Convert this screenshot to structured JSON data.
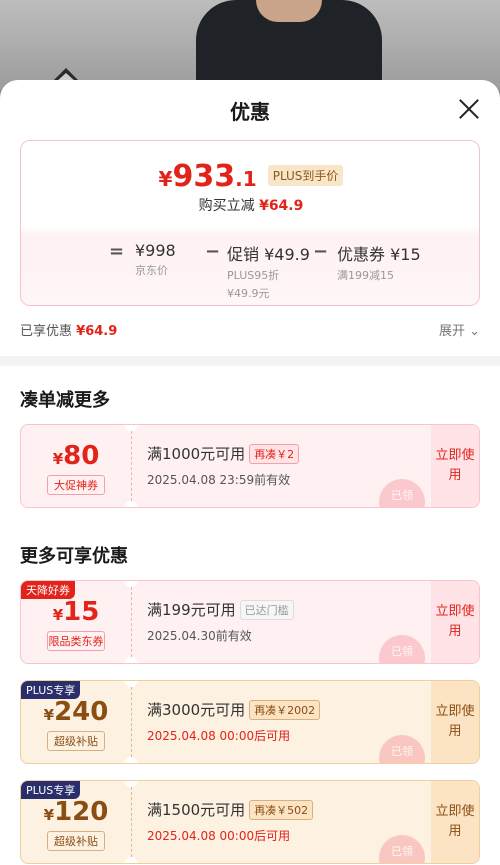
{
  "sheet": {
    "title": "优惠"
  },
  "summary": {
    "final_yen": "¥",
    "final_int": "933",
    "final_dec": ".1",
    "plus_tag": "PLUS到手价",
    "save_label": "购买立减",
    "save_amount": "¥64.9",
    "formula": {
      "eq": "=",
      "minus1": "−",
      "minus2": "−",
      "base_price": "¥998",
      "base_label": "京东价",
      "promo_price": "促销 ¥49.9",
      "promo_sub1": "PLUS95折",
      "promo_sub2": "¥49.9元",
      "coupon_price": "优惠券 ¥15",
      "coupon_sub": "满199减15"
    },
    "enjoyed_label": "已享优惠",
    "enjoyed_amount": "¥64.9",
    "expand_label": "展开"
  },
  "sections": {
    "combine_title": "凑单减更多",
    "more_title": "更多可享优惠"
  },
  "coupons": [
    {
      "yen": "¥",
      "value": "80",
      "type": "大促神券",
      "condition": "满1000元可用",
      "badge": "再凑￥2",
      "date": "2025.04.08 23:59前有效",
      "action": "立即使用",
      "stamp": "已领"
    },
    {
      "corner": "天降好券",
      "yen": "¥",
      "value": "15",
      "type": "限品类东券",
      "condition": "满199元可用",
      "badge": "已达门槛",
      "date": "2025.04.30前有效",
      "action": "立即使用",
      "stamp": "已领"
    },
    {
      "corner": "PLUS专享",
      "yen": "¥",
      "value": "240",
      "type": "超级补贴",
      "condition": "满3000元可用",
      "badge": "再凑￥2002",
      "date": "2025.04.08 00:00后可用",
      "action": "立即使用",
      "stamp": "已领"
    },
    {
      "corner": "PLUS专享",
      "yen": "¥",
      "value": "120",
      "type": "超级补贴",
      "condition": "满1500元可用",
      "badge": "再凑￥502",
      "date": "2025.04.08 00:00后可用",
      "action": "立即使用",
      "stamp": "已领"
    }
  ],
  "colors": {
    "accent_red": "#e2231a",
    "gold_text": "#8b4e12",
    "plus_navy": "#2a2f6b"
  },
  "icons": {
    "close": "close-icon",
    "expand": "chevron-down-icon"
  }
}
